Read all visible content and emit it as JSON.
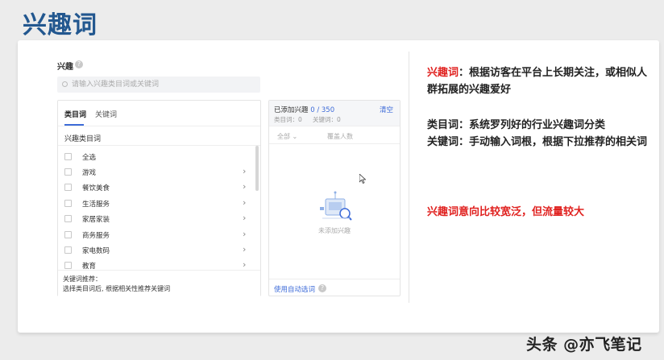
{
  "slide": {
    "title": "兴趣词"
  },
  "form": {
    "section_label": "兴趣",
    "search_placeholder": "请输入兴趣类目词或关键词",
    "tabs": [
      "类目词",
      "关键词"
    ],
    "subhead": "兴趣类目词",
    "items": [
      "全选",
      "游戏",
      "餐饮美食",
      "生活服务",
      "家居家装",
      "商务服务",
      "家电数码",
      "教育"
    ],
    "footer_line1": "关键词推荐：",
    "footer_line2": "选择类目词后, 根据相关性推荐关键词"
  },
  "right_panel": {
    "added_label": "已添加兴趣",
    "added_count": "0 / 350",
    "clear_label": "清空",
    "category_count": "类目词：0",
    "keyword_count": "关键词：0",
    "filter_label": "全部 ⌄",
    "reset_label": "覆盖人数",
    "empty_text": "未添加兴趣",
    "auto_select_label": "使用自动选词"
  },
  "notes": {
    "n1_red": "兴趣词",
    "n1_rest": "：根据访客在平台上长期关注，或相似人群拓展的兴趣爱好",
    "n2_line1": "类目词：系统罗列好的行业兴趣词分类",
    "n2_line2": "关键词：手动输入词根，根据下拉推荐的相关词",
    "n3": "兴趣词意向比较宽泛，但流量较大"
  },
  "watermark": "头条 @亦飞笔记",
  "colors": {
    "title": "#22578f",
    "accent": "#3d6bd8",
    "highlight": "#e0211f"
  }
}
